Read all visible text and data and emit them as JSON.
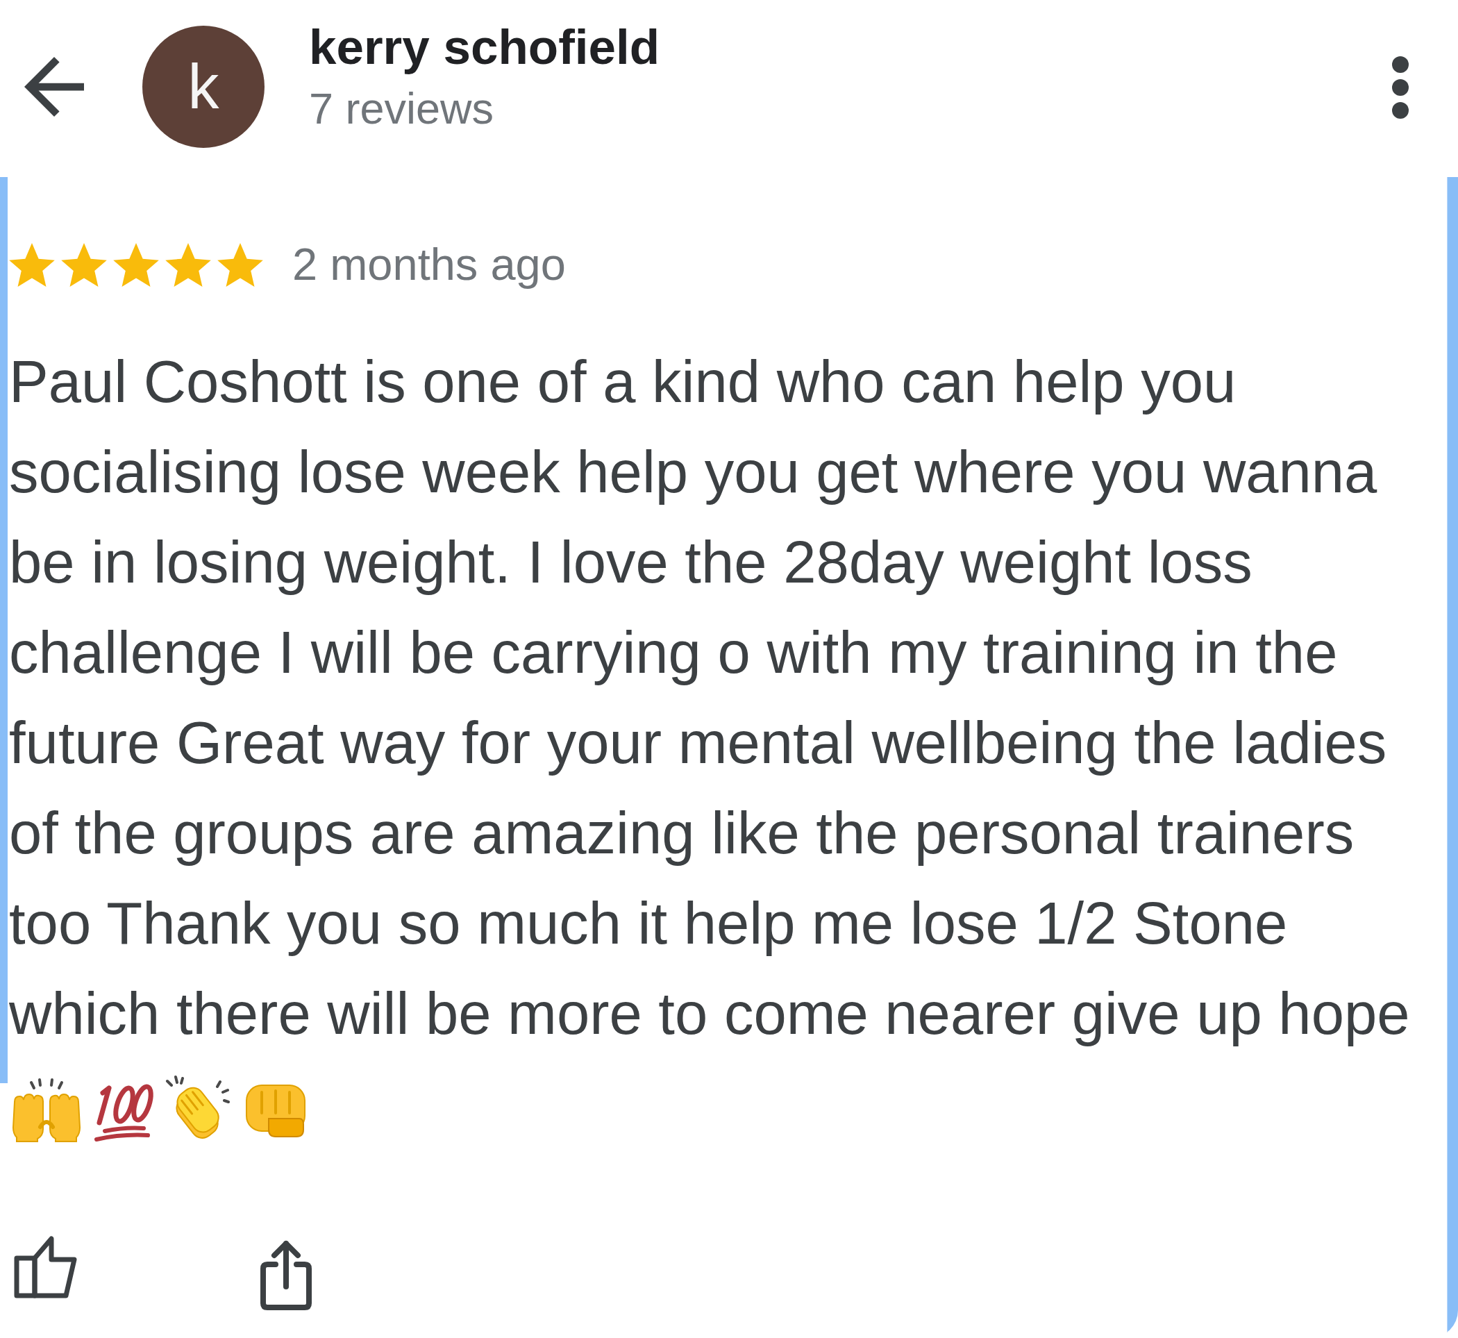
{
  "reviewer": {
    "avatar_letter": "k",
    "name": "kerry schofield",
    "review_count": "7 reviews"
  },
  "review": {
    "stars": 5,
    "time": "2 months ago",
    "text": "Paul Coshott is one of a kind who can help you socialising lose week help you get where you wanna be in losing weight. I love the 28day weight loss challenge I will be carrying o with my training in the future Great way for your mental wellbeing the ladies of the groups are amazing like the personal trainers too Thank you so much it help me lose 1/2 Stone which there will be more to come nearer give up hope"
  }
}
